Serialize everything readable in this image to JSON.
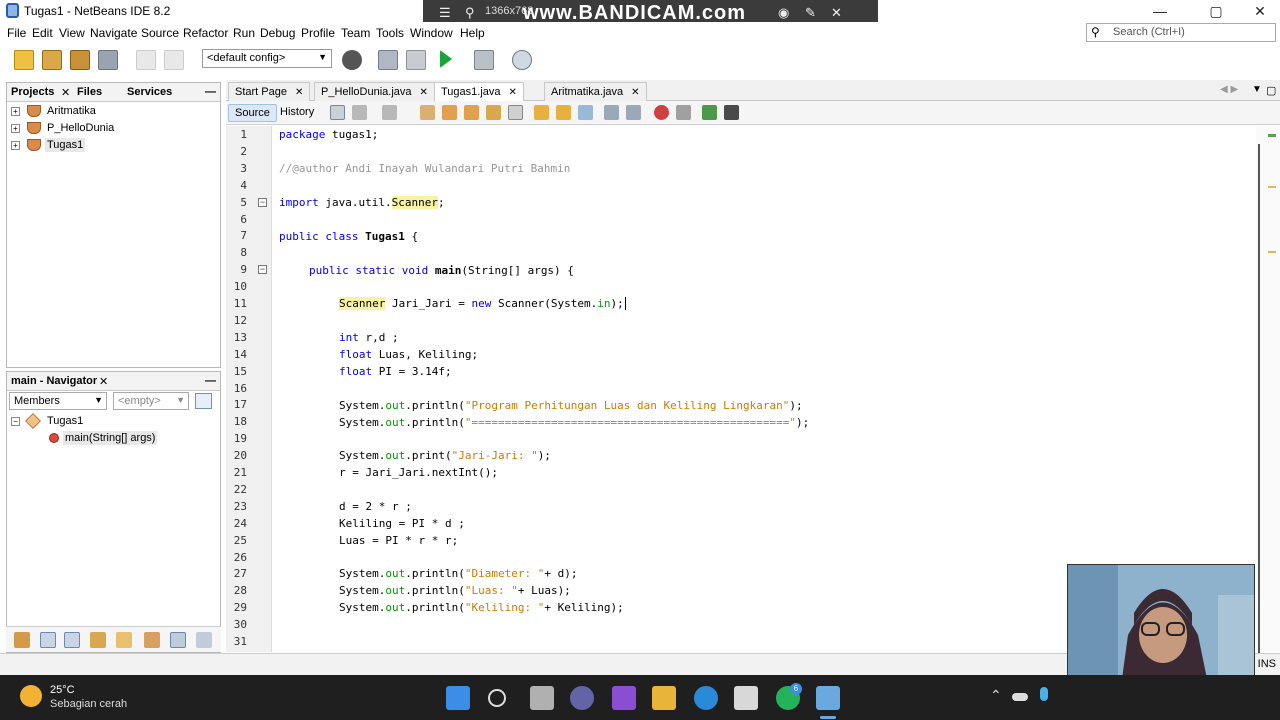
{
  "window": {
    "title": "Tugas1 - NetBeans IDE 8.2"
  },
  "recorder": {
    "resolution": "1366x768",
    "brand": "www.BANDICAM.com"
  },
  "menu": [
    "File",
    "Edit",
    "View",
    "Navigate",
    "Source",
    "Refactor",
    "Run",
    "Debug",
    "Profile",
    "Team",
    "Tools",
    "Window",
    "Help"
  ],
  "search": {
    "placeholder": "Search (Ctrl+I)"
  },
  "toolbar": {
    "config_value": "<default config>"
  },
  "projects_panel": {
    "tabs": [
      "Projects",
      "Files",
      "Services"
    ],
    "items": [
      "Aritmatika",
      "P_HelloDunia",
      "Tugas1"
    ]
  },
  "navigator": {
    "title": "main - Navigator",
    "members_select": "Members",
    "filter_select": "<empty>",
    "class_name": "Tugas1",
    "method_name": "main(String[] args)"
  },
  "editor": {
    "tabs": [
      "Start Page",
      "P_HelloDunia.java",
      "Tugas1.java",
      "Aritmatika.java"
    ],
    "active_tab": "Tugas1.java",
    "source_label": "Source",
    "history_label": "History",
    "line_count": 31,
    "current_line": 11
  },
  "code_lines": {
    "l1_kw": "package",
    "l1_rest": " tugas1;",
    "l3": "//@author Andi Inayah Wulandari Putri Bahmin",
    "l5_kw": "import",
    "l5_pkg": " java.util.",
    "l5_hl": "Scanner",
    "l5_end": ";",
    "l7_kw": "public class",
    "l7_name": " Tugas1",
    "l7_end": " {",
    "l9_kw": "public static void",
    "l9_name": " main",
    "l9_rest": "(String[] args) {",
    "l11_hl": "Scanner",
    "l11_a": " Jari_Jari = ",
    "l11_kw": "new",
    "l11_b": " Scanner(System.",
    "l11_fld": "in",
    "l11_c": ");",
    "l13_kw": "int",
    "l13_rest": " r,d ;",
    "l14_kw": "float",
    "l14_rest": " Luas, Keliling;",
    "l15_kw": "float",
    "l15_rest": " PI = 3.14f;",
    "l17_a": "System.",
    "l17_fld": "out",
    "l17_b": ".println(",
    "l17_str": "\"Program Perhitungan Luas dan Keliling Lingkaran\"",
    "l17_c": ");",
    "l18_a": "System.",
    "l18_fld": "out",
    "l18_b": ".println(",
    "l18_str": "\"================================================\"",
    "l18_c": ");",
    "l20_a": "System.",
    "l20_fld": "out",
    "l20_b": ".print(",
    "l20_str": "\"Jari-Jari: \"",
    "l20_c": ");",
    "l21": "r = Jari_Jari.nextInt();",
    "l23": "d = 2 * r ;",
    "l24": "Keliling = PI * d ;",
    "l25": "Luas = PI * r * r;",
    "l27_a": "System.",
    "l27_fld": "out",
    "l27_b": ".println(",
    "l27_str": "\"Diameter: \"",
    "l27_c": "+ d);",
    "l28_a": "System.",
    "l28_fld": "out",
    "l28_b": ".println(",
    "l28_str": "\"Luas: \"",
    "l28_c": "+ Luas);",
    "l29_a": "System.",
    "l29_fld": "out",
    "l29_b": ".println(",
    "l29_str": "\"Keliling: \"",
    "l29_c": "+ Keliling);"
  },
  "status": {
    "mode": "INS"
  },
  "taskbar": {
    "temperature": "25°C",
    "weather": "Sebagian cerah",
    "whatsapp_badge": "6"
  },
  "colors": {
    "keyword": "#0000e6",
    "string": "#ce7b00",
    "comment": "#969696",
    "field": "#009900",
    "highlight": "#f7f3a3",
    "taskbar": "#1f1f1f"
  }
}
